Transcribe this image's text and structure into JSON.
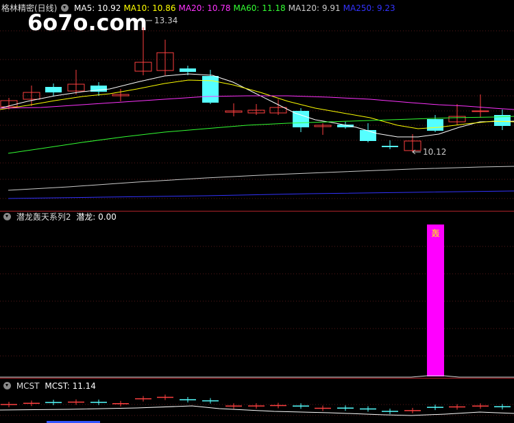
{
  "main_panel": {
    "title": "格林精密(日线)",
    "ma_items": [
      {
        "label": "MA5: 10.92",
        "color": "#ffffff"
      },
      {
        "label": "MA10: 10.86",
        "color": "#ffff00"
      },
      {
        "label": "MA20: 10.78",
        "color": "#ff33ff"
      },
      {
        "label": "MA60: 11.18",
        "color": "#33ff33"
      },
      {
        "label": "MA120: 9.91",
        "color": "#cccccc"
      },
      {
        "label": "MA250: 9.23",
        "color": "#3333ff"
      }
    ],
    "high_label": "13.34",
    "low_label": "10.12"
  },
  "watermark": "6o7o.com",
  "indicator_panel": {
    "title": "潜龙轰天系列2",
    "value_label": "潜龙: 0.00",
    "bar_text": "轰",
    "bar_color": "#ff00ff"
  },
  "mcst_panel": {
    "title": "MCST",
    "value_label": "MCST: 11.14"
  }
}
